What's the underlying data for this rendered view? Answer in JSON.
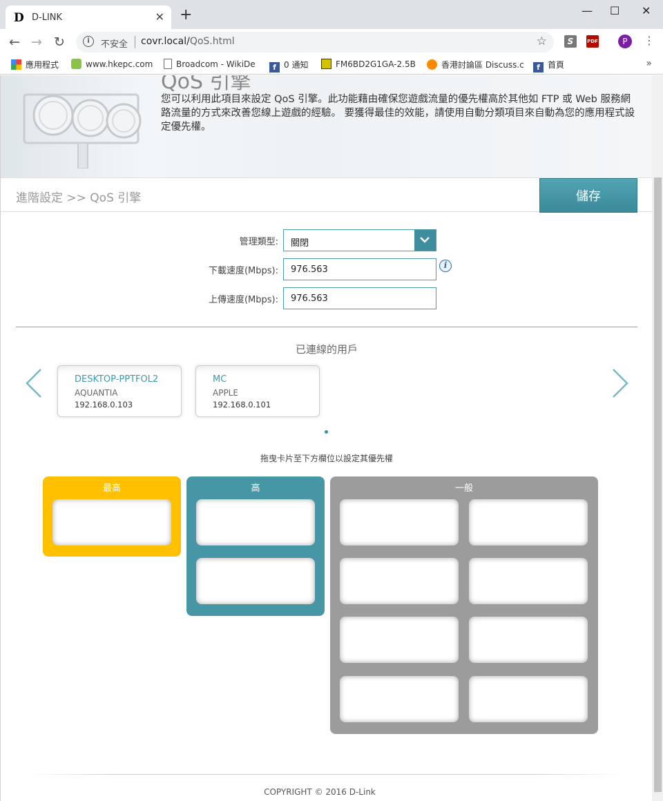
{
  "browser": {
    "tab_favicon": "D",
    "tab_title": "D-LINK",
    "tab_close": "✕",
    "new_tab": "+",
    "window_controls": {
      "minimize": "—",
      "maximize": "☐",
      "close": "✕"
    },
    "back": "←",
    "forward": "→",
    "reload": "↻",
    "omnibox": {
      "insecure_label": "不安全",
      "url_host": "covr.local/",
      "url_path": "QoS.html",
      "star": "☆"
    },
    "extensions": [
      "S",
      "PDF"
    ],
    "profile_initial": "P",
    "menu": "⋮",
    "bookmarks": [
      {
        "label": "應用程式",
        "icon": "apps-icon"
      },
      {
        "label": "www.hkepc.com",
        "icon": "hkepc-icon"
      },
      {
        "label": "Broadcom - WikiDe",
        "icon": "document-icon"
      },
      {
        "label": "0 通知",
        "icon": "facebook-icon"
      },
      {
        "label": "FM6BD2G1GA-2.5B",
        "icon": "chip-icon"
      },
      {
        "label": "香港討論區 Discuss.c",
        "icon": "discuss-icon"
      },
      {
        "label": "首頁",
        "icon": "facebook-icon"
      }
    ],
    "bookmarks_more": "»"
  },
  "banner": {
    "title": "QoS 引擎",
    "description": "您可以利用此項目來設定 QoS 引擎。此功能藉由確保您遊戲流量的優先權高於其他如 FTP 或 Web 服務網路流量的方式來改善您線上遊戲的經驗。 要獲得最佳的效能，請使用自動分類項目來自動為您的應用程式設定優先權。"
  },
  "breadcrumb": "進階設定 >> QoS 引擎",
  "save_label": "儲存",
  "form": {
    "management_type_label": "管理類型:",
    "management_type_value": "關閉",
    "download_label": "下載速度(Mbps):",
    "download_value": "976.563",
    "upload_label": "上傳速度(Mbps):",
    "upload_value": "976.563",
    "info_glyph": "i"
  },
  "connected_users": {
    "title": "已連線的用戶",
    "devices": [
      {
        "name": "DESKTOP-PPTFOL2",
        "vendor": "AQUANTIA",
        "ip": "192.168.0.103"
      },
      {
        "name": "MC",
        "vendor": "APPLE",
        "ip": "192.168.0.101"
      }
    ],
    "hint": "拖曳卡片至下方欄位以設定其優先權"
  },
  "priorities": {
    "highest": {
      "label": "最高",
      "color": "#ffc000"
    },
    "high": {
      "label": "高",
      "color": "#4696a6"
    },
    "normal": {
      "label": "一般",
      "color": "#9c9c9c"
    }
  },
  "copyright": "COPYRIGHT © 2016 D-Link",
  "colors": {
    "accent": "#3e8e9d",
    "link": "#3e9aaa"
  }
}
